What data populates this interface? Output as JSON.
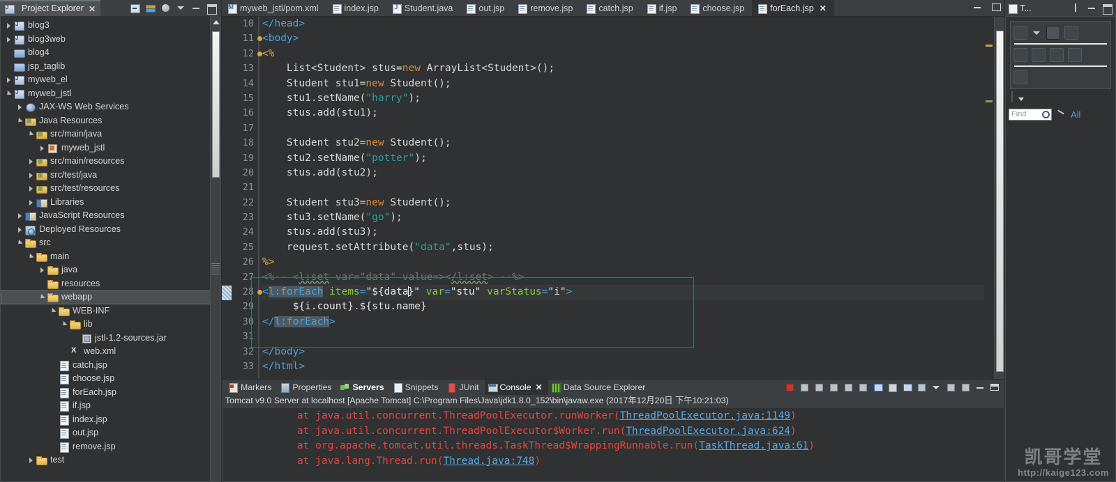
{
  "explorer": {
    "tab_title": "Project Explorer",
    "close_label": "✕",
    "tools": [
      "collapse-all-icon",
      "link-with-editor-icon",
      "view-menu-icon",
      "chevron-down-icon",
      "minimize-icon",
      "maximize-icon"
    ],
    "tree": [
      {
        "label": "blog3",
        "icon": "java-project-icon",
        "arrow": "closed",
        "indent": 0
      },
      {
        "label": "blog3web",
        "icon": "java-project-icon",
        "arrow": "closed",
        "indent": 0
      },
      {
        "label": "blog4",
        "icon": "blue-folder-icon",
        "arrow": "none",
        "indent": 0
      },
      {
        "label": "jsp_taglib",
        "icon": "blue-folder-icon",
        "arrow": "none",
        "indent": 0
      },
      {
        "label": "myweb_el",
        "icon": "java-project-icon",
        "arrow": "closed",
        "indent": 0
      },
      {
        "label": "myweb_jstl",
        "icon": "java-project-icon",
        "arrow": "open",
        "indent": 0
      },
      {
        "label": "JAX-WS Web Services",
        "icon": "web-service-icon",
        "arrow": "closed",
        "indent": 1
      },
      {
        "label": "Java Resources",
        "icon": "src-folder-icon",
        "arrow": "open",
        "indent": 1
      },
      {
        "label": "src/main/java",
        "icon": "src-folder-icon",
        "arrow": "open",
        "indent": 2
      },
      {
        "label": "myweb_jstl",
        "icon": "package-icon",
        "arrow": "closed",
        "indent": 3
      },
      {
        "label": "src/main/resources",
        "icon": "src-folder-icon",
        "arrow": "closed",
        "indent": 2
      },
      {
        "label": "src/test/java",
        "icon": "src-folder-icon",
        "arrow": "closed",
        "indent": 2
      },
      {
        "label": "src/test/resources",
        "icon": "src-folder-icon",
        "arrow": "closed",
        "indent": 2
      },
      {
        "label": "Libraries",
        "icon": "libraries-icon",
        "arrow": "closed",
        "indent": 2
      },
      {
        "label": "JavaScript Resources",
        "icon": "libraries-icon",
        "arrow": "closed",
        "indent": 1
      },
      {
        "label": "Deployed Resources",
        "icon": "deployed-resources-icon",
        "arrow": "closed",
        "indent": 1
      },
      {
        "label": "src",
        "icon": "folder-icon",
        "arrow": "open",
        "indent": 1
      },
      {
        "label": "main",
        "icon": "folder-icon",
        "arrow": "open",
        "indent": 2
      },
      {
        "label": "java",
        "icon": "folder-icon",
        "arrow": "closed",
        "indent": 3
      },
      {
        "label": "resources",
        "icon": "folder-icon",
        "arrow": "none",
        "indent": 3
      },
      {
        "label": "webapp",
        "icon": "folder-icon",
        "arrow": "open",
        "indent": 3,
        "selected": true
      },
      {
        "label": "WEB-INF",
        "icon": "folder-icon",
        "arrow": "open",
        "indent": 4
      },
      {
        "label": "lib",
        "icon": "folder-icon",
        "arrow": "open",
        "indent": 5
      },
      {
        "label": "jstl-1.2-sources.jar",
        "icon": "jar-icon",
        "arrow": "none",
        "indent": 6
      },
      {
        "label": "web.xml",
        "icon": "xml-file-icon",
        "arrow": "none",
        "indent": 5
      },
      {
        "label": "catch.jsp",
        "icon": "jsp-file-icon",
        "arrow": "none",
        "indent": 4
      },
      {
        "label": "choose.jsp",
        "icon": "jsp-file-icon",
        "arrow": "none",
        "indent": 4
      },
      {
        "label": "forEach.jsp",
        "icon": "jsp-file-icon",
        "arrow": "none",
        "indent": 4
      },
      {
        "label": "if.jsp",
        "icon": "jsp-file-icon",
        "arrow": "none",
        "indent": 4
      },
      {
        "label": "index.jsp",
        "icon": "jsp-file-icon",
        "arrow": "none",
        "indent": 4
      },
      {
        "label": "out.jsp",
        "icon": "jsp-file-icon",
        "arrow": "none",
        "indent": 4
      },
      {
        "label": "remove.jsp",
        "icon": "jsp-file-icon",
        "arrow": "none",
        "indent": 4
      },
      {
        "label": "test",
        "icon": "folder-icon",
        "arrow": "closed",
        "indent": 2
      }
    ]
  },
  "editor": {
    "tabs": [
      {
        "label": "myweb_jstl/pom.xml",
        "icon": "maven-file-icon",
        "active": false,
        "closable": false
      },
      {
        "label": "index.jsp",
        "icon": "jsp-file-icon",
        "active": false,
        "closable": false
      },
      {
        "label": "Student.java",
        "icon": "java-file-icon",
        "active": false,
        "closable": false
      },
      {
        "label": "out.jsp",
        "icon": "jsp-file-icon",
        "active": false,
        "closable": false
      },
      {
        "label": "remove.jsp",
        "icon": "jsp-file-icon",
        "active": false,
        "closable": false
      },
      {
        "label": "catch.jsp",
        "icon": "jsp-file-icon",
        "active": false,
        "closable": false
      },
      {
        "label": "if.jsp",
        "icon": "jsp-file-icon",
        "active": false,
        "closable": false
      },
      {
        "label": "choose.jsp",
        "icon": "jsp-file-icon",
        "active": false,
        "closable": false
      },
      {
        "label": "forEach.jsp",
        "icon": "jsp-file-icon",
        "active": true,
        "closable": true,
        "close_label": "✕"
      }
    ],
    "window_controls": [
      "minimize-icon",
      "maximize-icon"
    ],
    "first_visible_line": 10,
    "current_line": 28,
    "lines": [
      {
        "n": 10,
        "fold": false,
        "text": "</head>"
      },
      {
        "n": 11,
        "fold": true,
        "text": "<body>"
      },
      {
        "n": 12,
        "fold": true,
        "text": "<%"
      },
      {
        "n": 13,
        "fold": false,
        "text": "    List<Student> stus=new ArrayList<Student>();"
      },
      {
        "n": 14,
        "fold": false,
        "text": "    Student stu1=new Student();"
      },
      {
        "n": 15,
        "fold": false,
        "text": "    stu1.setName(\"harry\");"
      },
      {
        "n": 16,
        "fold": false,
        "text": "    stus.add(stu1);"
      },
      {
        "n": 17,
        "fold": false,
        "text": ""
      },
      {
        "n": 18,
        "fold": false,
        "text": "    Student stu2=new Student();"
      },
      {
        "n": 19,
        "fold": false,
        "text": "    stu2.setName(\"potter\");"
      },
      {
        "n": 20,
        "fold": false,
        "text": "    stus.add(stu2);"
      },
      {
        "n": 21,
        "fold": false,
        "text": ""
      },
      {
        "n": 22,
        "fold": false,
        "text": "    Student stu3=new Student();"
      },
      {
        "n": 23,
        "fold": false,
        "text": "    stu3.setName(\"go\");"
      },
      {
        "n": 24,
        "fold": false,
        "text": "    stus.add(stu3);"
      },
      {
        "n": 25,
        "fold": false,
        "text": "    request.setAttribute(\"data\",stus);"
      },
      {
        "n": 26,
        "fold": false,
        "text": "%>"
      },
      {
        "n": 27,
        "fold": false,
        "text": "<%-- <l:set var=\"data\" value=></l:set> --%>"
      },
      {
        "n": 28,
        "fold": true,
        "text": "<l:forEach items=\"${data}\" var=\"stu\" varStatus=\"i\">"
      },
      {
        "n": 29,
        "fold": false,
        "text": "     ${i.count}.${stu.name}"
      },
      {
        "n": 30,
        "fold": false,
        "text": "</l:forEach>"
      },
      {
        "n": 31,
        "fold": false,
        "text": ""
      },
      {
        "n": 32,
        "fold": false,
        "text": "</body>"
      },
      {
        "n": 33,
        "fold": false,
        "text": "</html>"
      }
    ]
  },
  "console": {
    "tabs": [
      {
        "label": "Markers",
        "icon": "markers-icon",
        "state": "normal"
      },
      {
        "label": "Properties",
        "icon": "properties-icon",
        "state": "normal"
      },
      {
        "label": "Servers",
        "icon": "servers-icon",
        "state": "bold"
      },
      {
        "label": "Snippets",
        "icon": "snippets-icon",
        "state": "normal"
      },
      {
        "label": "JUnit",
        "icon": "junit-icon",
        "state": "normal"
      },
      {
        "label": "Console",
        "icon": "console-icon",
        "state": "active",
        "close_label": "✕"
      },
      {
        "label": "Data Source Explorer",
        "icon": "data-source-icon",
        "state": "normal"
      }
    ],
    "tools": [
      "terminate-icon",
      "remove-launch-icon",
      "remove-all-launches-icon",
      "open-console-icon",
      "display-selected-console-icon",
      "pin-console-icon",
      "scroll-lock-icon",
      "clear-console-icon",
      "word-wrap-icon",
      "show-console-icon",
      "chevron-down-icon",
      "new-console-icon",
      "view-menu-icon",
      "minimize-icon",
      "maximize-icon"
    ],
    "title": "Tomcat v9.0 Server at localhost [Apache Tomcat] C:\\Program Files\\Java\\jdk1.8.0_152\\bin\\javaw.exe (2017年12月20日 下午10:21:03)",
    "stacktrace": [
      {
        "prefix": "    at java.util.concurrent.ThreadPoolExecutor.runWorker(",
        "link": "ThreadPoolExecutor.java:1149",
        "suffix": ")"
      },
      {
        "prefix": "    at java.util.concurrent.ThreadPoolExecutor$Worker.run(",
        "link": "ThreadPoolExecutor.java:624",
        "suffix": ")"
      },
      {
        "prefix": "    at org.apache.tomcat.util.threads.TaskThread$WrappingRunnable.run(",
        "link": "TaskThread.java:61",
        "suffix": ")"
      },
      {
        "prefix": "    at java.lang.Thread.run(",
        "link": "Thread.java:748",
        "suffix": ")"
      }
    ]
  },
  "right_panel": {
    "tab_title": "T...",
    "tools": [
      "focus-icon",
      "minimize-icon",
      "maximize-icon"
    ],
    "toolbar_row1": [
      "new-icon",
      "chevron-down-icon",
      "hierarchy-icon",
      "filter-icon"
    ],
    "toolbar_row2": [
      "group-icon",
      "hide-fields-icon",
      "hide-static-icon",
      "collapse-icon"
    ],
    "toolbar_row3": [
      "sort-icon"
    ],
    "menu_caret": "chevron-down-icon",
    "find_placeholder": "Find",
    "find_value": "",
    "all_label": "All"
  },
  "watermark": {
    "title": "凯哥学堂",
    "url": "http://kaige123.com"
  },
  "colors": {
    "bg": "#3c3f41",
    "panel_bg": "#2f3133",
    "tag": "#4aa3dd",
    "attr": "#8cc63f",
    "string": "#2aa198",
    "keyword": "#d98a3a",
    "directive": "#d6b84c",
    "comment": "#6f7a6a",
    "error": "#e8453c",
    "link": "#5aa9e6",
    "annotation_box": "#e4243c"
  }
}
